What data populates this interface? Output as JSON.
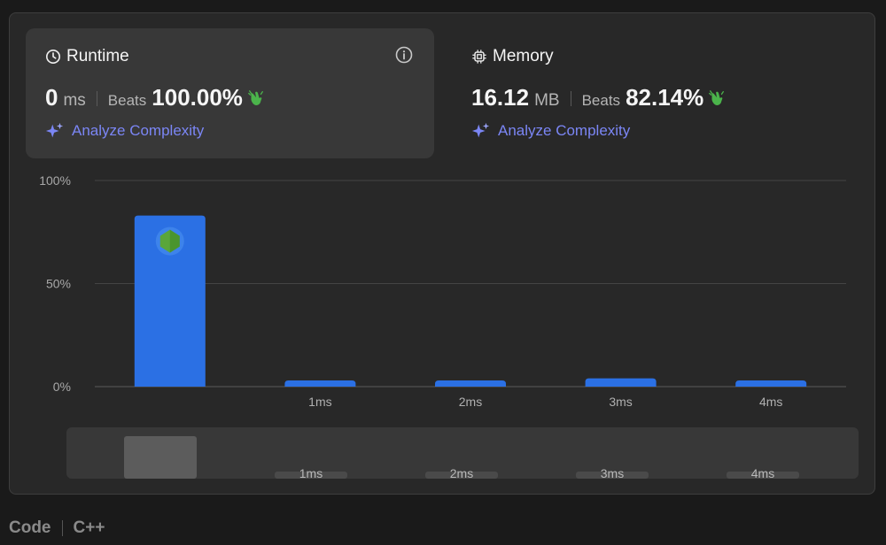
{
  "runtime": {
    "title": "Runtime",
    "value": "0",
    "unit": "ms",
    "beats_label": "Beats",
    "beats_value": "100.00%",
    "analyze_label": "Analyze Complexity"
  },
  "memory": {
    "title": "Memory",
    "value": "16.12",
    "unit": "MB",
    "beats_label": "Beats",
    "beats_value": "82.14%",
    "analyze_label": "Analyze Complexity"
  },
  "colors": {
    "bar": "#2b70e4",
    "analyze": "#7b86f5",
    "hand": "#4bb44b"
  },
  "chart_data": {
    "type": "bar",
    "categories": [
      "",
      "1ms",
      "2ms",
      "3ms",
      "4ms"
    ],
    "values": [
      83,
      3,
      3,
      4,
      3
    ],
    "ylim": [
      0,
      100
    ],
    "yticks": [
      "100%",
      "50%",
      "0%"
    ],
    "highlight_index": 0,
    "overview": {
      "labels": [
        "",
        "1ms",
        "2ms",
        "3ms",
        "4ms"
      ],
      "values": [
        83,
        3,
        3,
        4,
        3
      ]
    }
  },
  "footer": {
    "code_label": "Code",
    "language": "C++"
  }
}
